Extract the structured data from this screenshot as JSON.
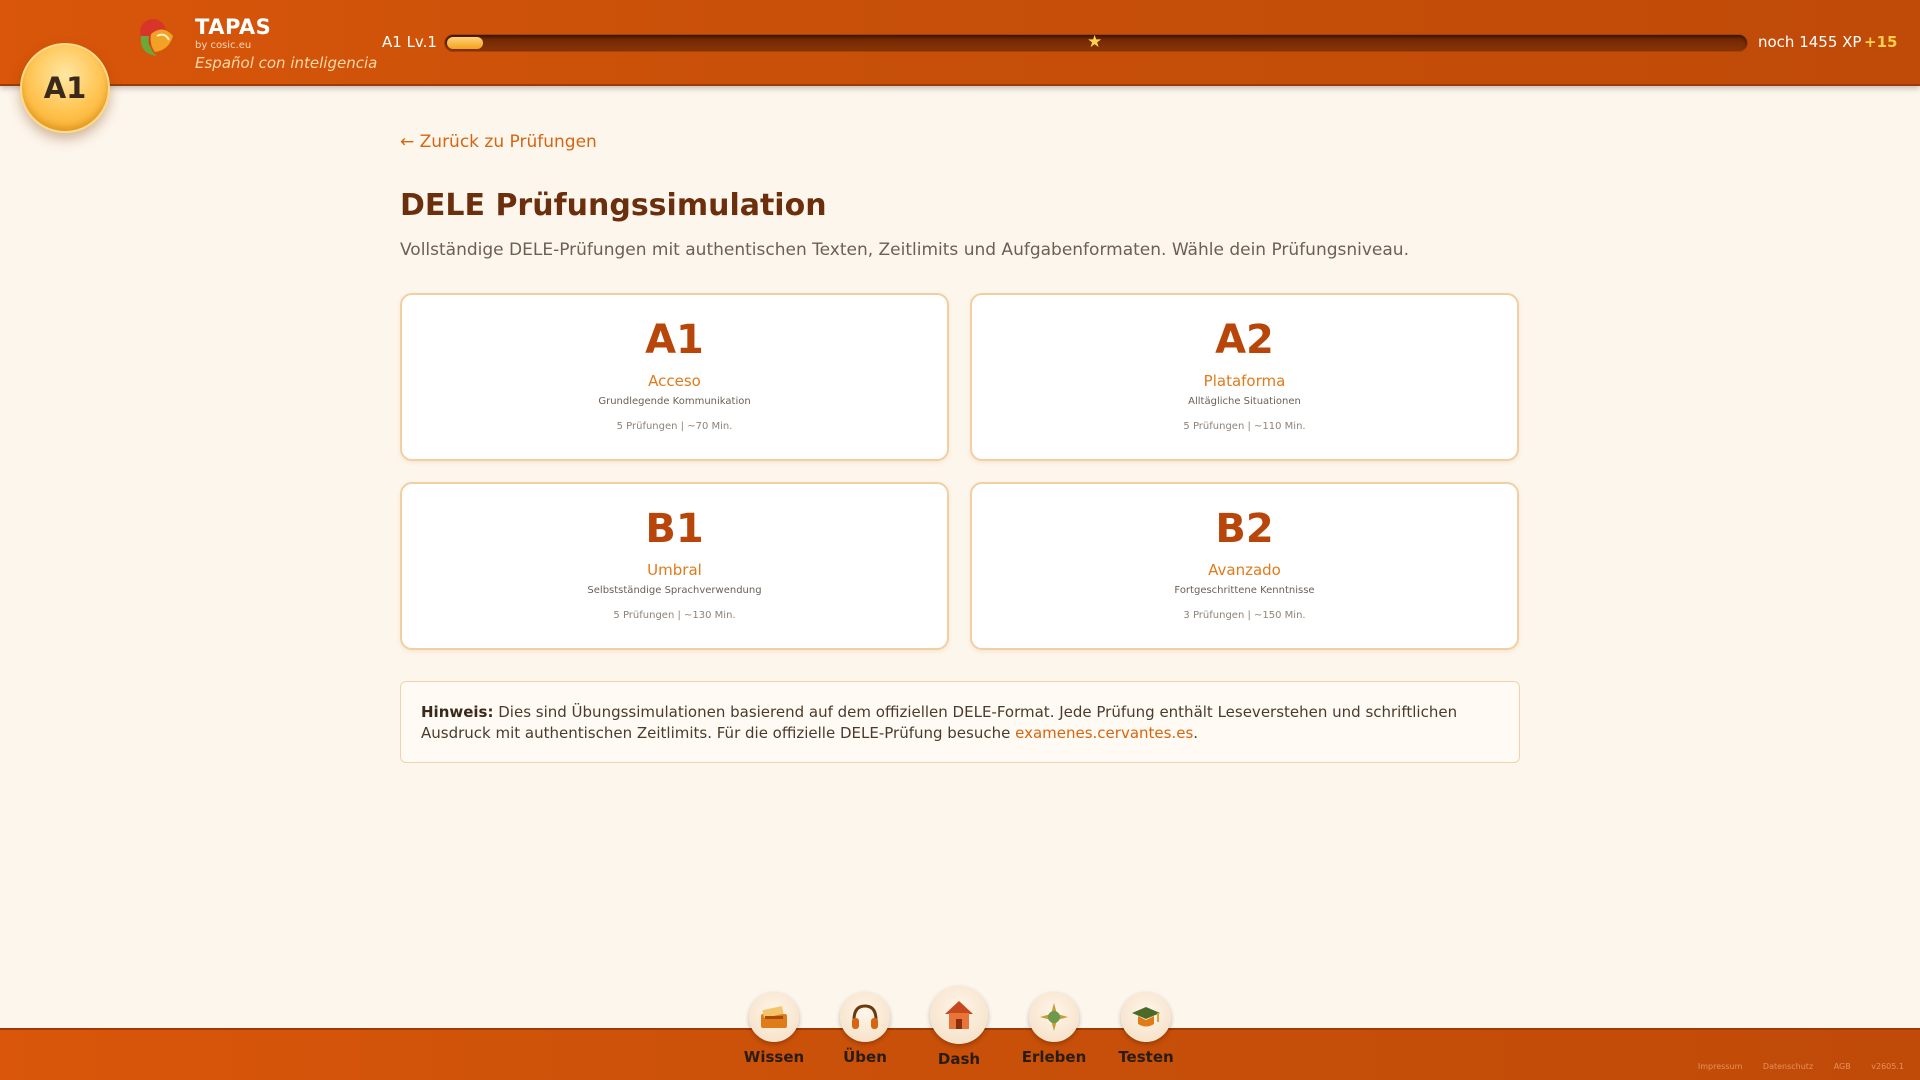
{
  "header": {
    "level_badge": "A1",
    "brand_title": "TAPAS",
    "brand_by": "by cosic.eu",
    "brand_tagline": "Español con inteligencia",
    "xp_level": "A1 Lv.1",
    "xp_progress": 0.028,
    "xp_remaining": "noch 1455 XP",
    "xp_gain": "+15"
  },
  "main": {
    "back_link": "← Zurück zu Prüfungen",
    "title": "DELE Prüfungssimulation",
    "subtitle": "Vollständige DELE-Prüfungen mit authentischen Texten, Zeitlimits und Aufgabenformaten. Wähle dein Prüfungsniveau.",
    "levels": [
      {
        "level": "A1",
        "name": "Acceso",
        "desc": "Grundlegende Kommunikation",
        "meta": "5 Prüfungen | ~70 Min."
      },
      {
        "level": "A2",
        "name": "Plataforma",
        "desc": "Alltägliche Situationen",
        "meta": "5 Prüfungen | ~110 Min."
      },
      {
        "level": "B1",
        "name": "Umbral",
        "desc": "Selbstständige Sprachverwendung",
        "meta": "5 Prüfungen | ~130 Min."
      },
      {
        "level": "B2",
        "name": "Avanzado",
        "desc": "Fortgeschrittene Kenntnisse",
        "meta": "3 Prüfungen | ~150 Min."
      }
    ],
    "note": {
      "label": "Hinweis:",
      "text": " Dies sind Übungssimulationen basierend auf dem offiziellen DELE-Format. Jede Prüfung enthält Leseverstehen und schriftlichen Ausdruck mit authentischen Zeitlimits. Für die offizielle DELE-Prüfung besuche ",
      "link": "examenes.cervantes.es",
      "end": "."
    }
  },
  "nav": {
    "items": [
      {
        "label": "Wissen",
        "icon": "book-icon"
      },
      {
        "label": "Üben",
        "icon": "headphones-icon"
      },
      {
        "label": "Dash",
        "icon": "house-icon"
      },
      {
        "label": "Erleben",
        "icon": "compass-icon"
      },
      {
        "label": "Testen",
        "icon": "graduation-cap-icon"
      }
    ]
  },
  "footer": {
    "links": [
      "Impressum",
      "Datenschutz",
      "AGB",
      "v2605.1"
    ]
  },
  "colors": {
    "header": "#c85009",
    "accent": "#d9640f",
    "title": "#6b2f0d",
    "card_border": "#f2cfa3",
    "background": "#fdf6ec"
  }
}
